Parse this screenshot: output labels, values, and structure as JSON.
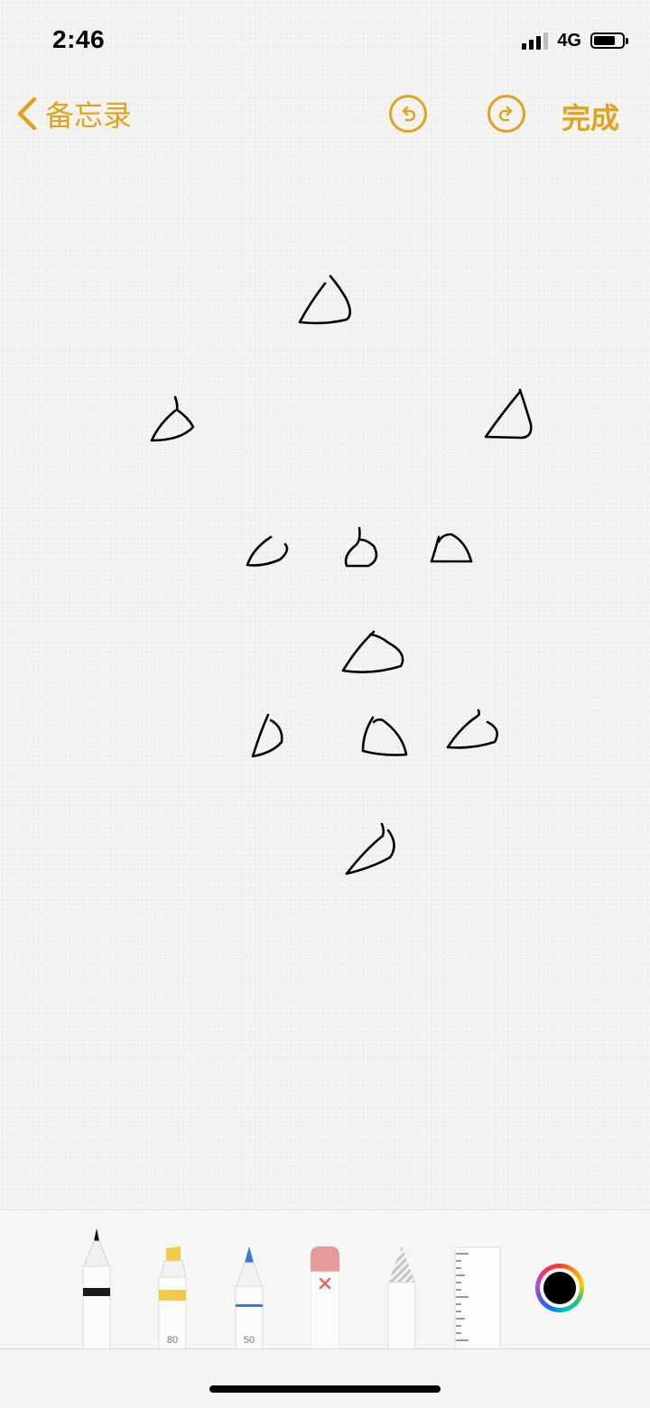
{
  "status_bar": {
    "time": "2:46",
    "network": "4G",
    "signal_bars": 4,
    "signal_bars_active": 3,
    "battery_level": 0.78
  },
  "nav": {
    "back_label": "备忘录",
    "done_label": "完成",
    "undo_icon": "undo-icon",
    "redo_icon": "redo-icon",
    "accent_color": "#e0a31e"
  },
  "canvas": {
    "ink_color": "#000000",
    "stroke_count": 12
  },
  "toolbar": {
    "tools": [
      {
        "name": "pen",
        "icon": "pen-icon"
      },
      {
        "name": "marker",
        "icon": "marker-icon",
        "label": "80"
      },
      {
        "name": "pencil",
        "icon": "pencil-icon",
        "label": "50"
      },
      {
        "name": "eraser",
        "icon": "eraser-icon"
      },
      {
        "name": "lasso",
        "icon": "lasso-icon"
      },
      {
        "name": "ruler",
        "icon": "ruler-icon"
      }
    ],
    "selected_color": "#000000"
  }
}
